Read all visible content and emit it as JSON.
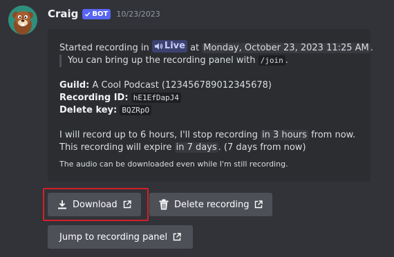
{
  "message": {
    "author": "Craig",
    "bot_badge": "BOT",
    "timestamp": "10/23/2023"
  },
  "embed": {
    "line1_prefix": "Started recording in",
    "channel": "Live",
    "line1_mid": "at",
    "datetime": "Monday, October 23, 2023 11:25 AM",
    "line1_end": ".",
    "quote_prefix": "You can bring up the recording panel with",
    "quote_command": "/join",
    "quote_end": ".",
    "guild_label": "Guild:",
    "guild_value": "A Cool Podcast (123456789012345678)",
    "recording_id_label": "Recording ID:",
    "recording_id_value": "hE1EfDapJ4",
    "delete_key_label": "Delete key:",
    "delete_key_value": "BQZRpO",
    "record_prefix": "I will record up to 6 hours, I'll stop recording",
    "record_time": "in 3 hours",
    "record_suffix": "from now.",
    "expire_prefix": "This recording will expire",
    "expire_time": "in 7 days",
    "expire_suffix": ". (7 days from now)",
    "footnote": "The audio can be downloaded even while I'm still recording."
  },
  "buttons": {
    "download": "Download",
    "delete": "Delete recording",
    "jump": "Jump to recording panel"
  },
  "colors": {
    "background": "#313338",
    "embed": "#2b2d31",
    "button": "#4e5058",
    "bot_badge": "#5865f2",
    "highlight_box": "#d3202a"
  }
}
